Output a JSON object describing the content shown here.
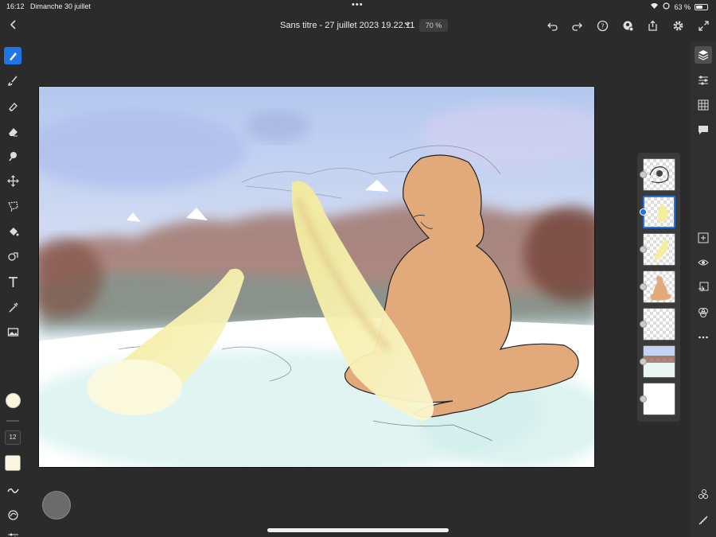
{
  "status": {
    "time": "16:12",
    "date": "Dimanche 30 juillet",
    "battery": "63 %",
    "battery_level": 0.63
  },
  "header": {
    "title": "Sans titre - 27 juillet 2023 19.22.11",
    "zoom": "70 %"
  },
  "top_icons": [
    "undo-icon",
    "redo-icon",
    "help-icon",
    "share-account-icon",
    "share-icon",
    "settings-icon",
    "fullscreen-icon"
  ],
  "left_tools": [
    "brush-select-icon",
    "brush-icon",
    "eraser-brush-icon",
    "eraser-icon",
    "smudge-icon",
    "move-icon",
    "lasso-icon",
    "fill-icon",
    "shape-icon",
    "text-icon",
    "eyedropper-icon",
    "image-icon"
  ],
  "brush": {
    "size": "12"
  },
  "colors": {
    "accent": "#1f74e8",
    "current": "#fbf7de",
    "background": "#2b2b2b"
  },
  "right_tools": [
    "layers-icon",
    "adjust-icon",
    "grid-icon",
    "comment-icon",
    "add-layer-icon",
    "visibility-icon",
    "import-icon",
    "blend-icon",
    "more-icon",
    "tools-icon",
    "ruler-icon"
  ],
  "layers": [
    {
      "name": "sketch-layer",
      "selected": false
    },
    {
      "name": "yellow-stroke-layer",
      "selected": true
    },
    {
      "name": "yellow-stroke-layer-2",
      "selected": false
    },
    {
      "name": "figure-layer",
      "selected": false
    },
    {
      "name": "empty-layer",
      "selected": false
    },
    {
      "name": "background-layer",
      "selected": false
    },
    {
      "name": "white-layer",
      "selected": false
    }
  ]
}
